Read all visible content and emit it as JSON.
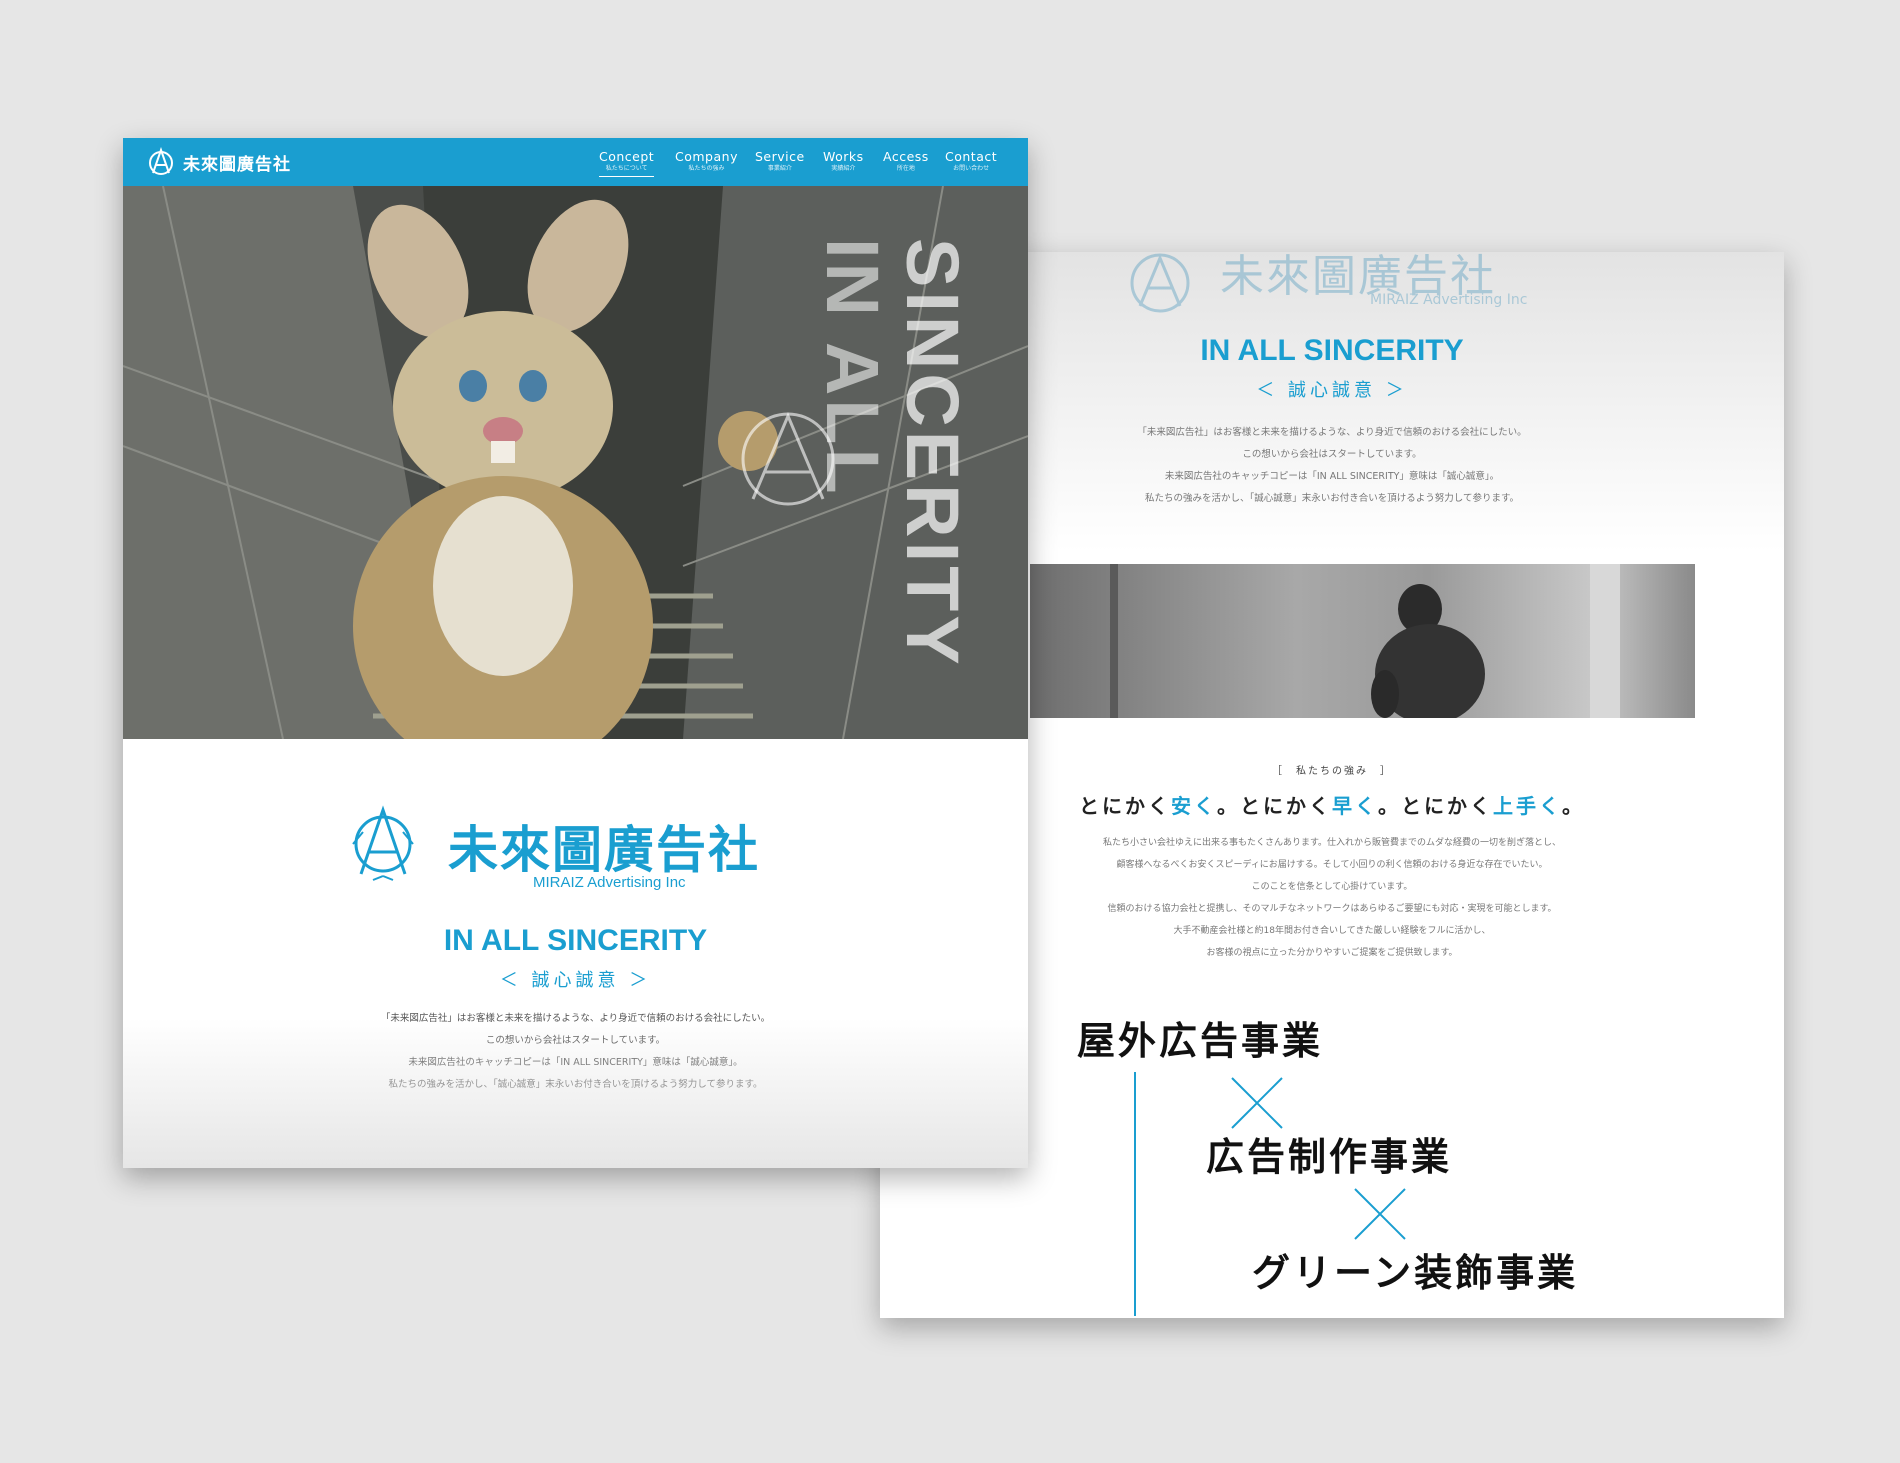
{
  "company": {
    "name_jp": "未來圖廣告社",
    "name_en": "MIRAIZ Advertising Inc"
  },
  "nav": {
    "items": [
      {
        "en": "Concept",
        "jp": "私たちについて"
      },
      {
        "en": "Company",
        "jp": "私たちの強み"
      },
      {
        "en": "Service",
        "jp": "事業紹介"
      },
      {
        "en": "Works",
        "jp": "実績紹介"
      },
      {
        "en": "Access",
        "jp": "所在地"
      },
      {
        "en": "Contact",
        "jp": "お問い合わせ"
      }
    ]
  },
  "hero": {
    "vertical_line1": "IN ALL",
    "vertical_line2": "SINCERITY"
  },
  "slogan": {
    "en": "IN ALL SINCERITY",
    "jp": "＜ 誠心誠意 ＞"
  },
  "intro": [
    "「未来図広告社」はお客様と未来を描けるような、より身近で信頼のおける会社にしたい。",
    "この想いから会社はスタートしています。",
    "未来図広告社のキャッチコピーは「IN ALL SINCERITY」意味は「誠心誠意」。",
    "私たちの強みを活かし、「誠心誠意」末永いお付き合いを頂けるよう努力して参ります。"
  ],
  "strength": {
    "label": "［　私たちの強み　］",
    "title_parts": [
      "とにかく",
      "安く",
      "。とにかく",
      "早く",
      "。とにかく",
      "上手く",
      "。"
    ],
    "body": [
      "私たち小さい会社ゆえに出来る事もたくさんあります。仕入れから販管費までのムダな経費の一切を削ぎ落とし、",
      "顧客様へなるべくお安くスピーディにお届けする。そして小回りの利く信頼のおける身近な存在でいたい。",
      "このことを信条として心掛けています。",
      "信頼のおける協力会社と提携し、そのマルチなネットワークはあらゆるご要望にも対応・実現を可能とします。",
      "大手不動産会社様と約18年間お付き合いしてきた厳しい経験をフルに活かし、",
      "お客様の視点に立った分かりやすいご提案をご提供致します。"
    ]
  },
  "businesses": [
    "屋外広告事業",
    "広告制作事業",
    "グリーン装飾事業"
  ],
  "colors": {
    "accent": "#1a9ed0",
    "background": "#e6e6e6"
  }
}
